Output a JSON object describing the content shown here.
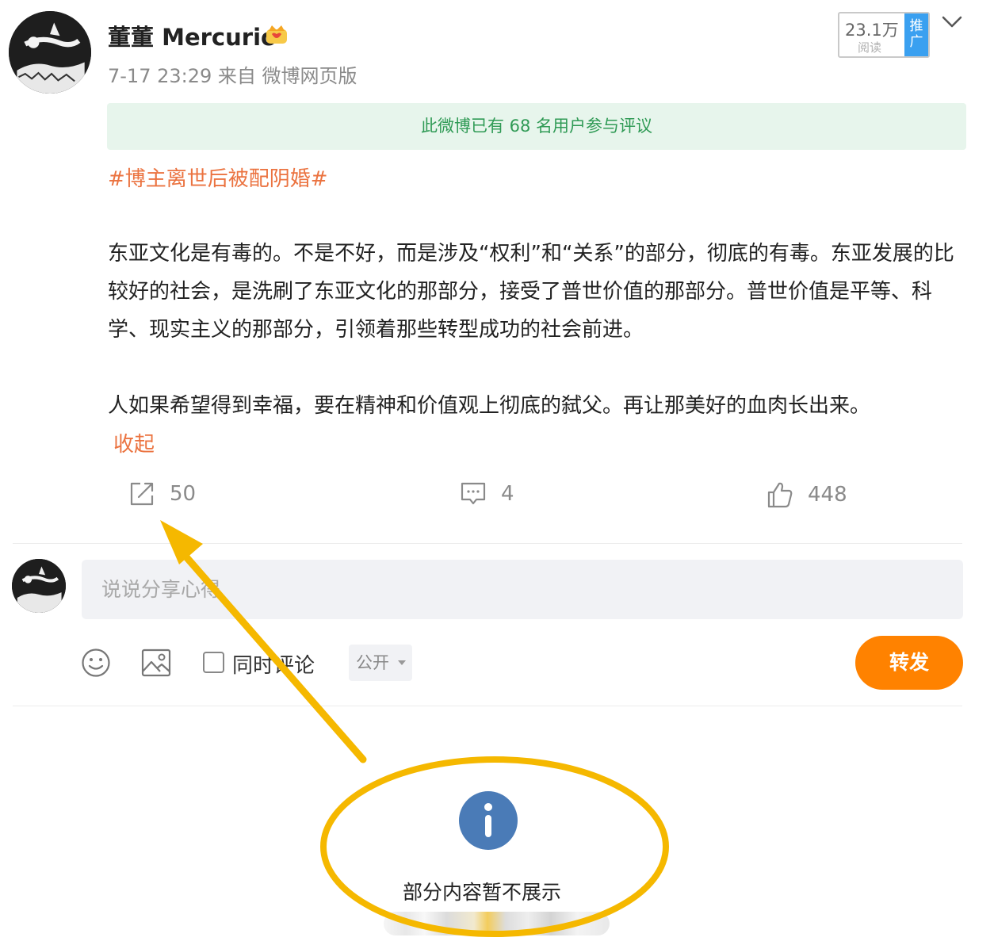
{
  "post": {
    "username": "董董 Mercurio",
    "meta": "7-17 23:29 来自 微博网页版",
    "read_count": "23.1万",
    "read_label": "阅读",
    "promo_tag": [
      "推",
      "广"
    ],
    "notice": "此微博已有 68 名用户参与评议",
    "hashtag": "#博主离世后被配阴婚#",
    "paragraph1": "东亚文化是有毒的。不是不好，而是涉及“权利”和“关系”的部分，彻底的有毒。东亚发展的比较好的社会，是洗刷了东亚文化的那部分，接受了普世价值的那部分。普世价值是平等、科学、现实主义的那部分，引领着那些转型成功的社会前进。",
    "paragraph2": "人如果希望得到幸福，要在精神和价值观上彻底的弑父。再让那美好的血肉长出来。",
    "collapse_label": "收起"
  },
  "actions": {
    "repost_count": "50",
    "comment_count": "4",
    "like_count": "448"
  },
  "composer": {
    "placeholder": "说说分享心得",
    "also_comment_label": "同时评论",
    "visibility": "公开",
    "submit_label": "转发"
  },
  "hidden_notice": {
    "text": "部分内容暂不展示"
  },
  "icons": {
    "repost": "share-icon",
    "comment": "comment-icon",
    "like": "thumbs-up-icon",
    "emoji": "smiley-icon",
    "image": "image-icon",
    "info": "info-icon",
    "more": "chevron-down-icon",
    "vip": "crown-icon"
  },
  "colors": {
    "brand_orange": "#ff8200",
    "link_orange": "#eb7340",
    "notice_green": "#2f9a55",
    "notice_bg": "#e7f5ec",
    "promo_blue": "#3aa0f0",
    "annotation_yellow": "#f5b800",
    "info_blue": "#4a7bb7"
  }
}
